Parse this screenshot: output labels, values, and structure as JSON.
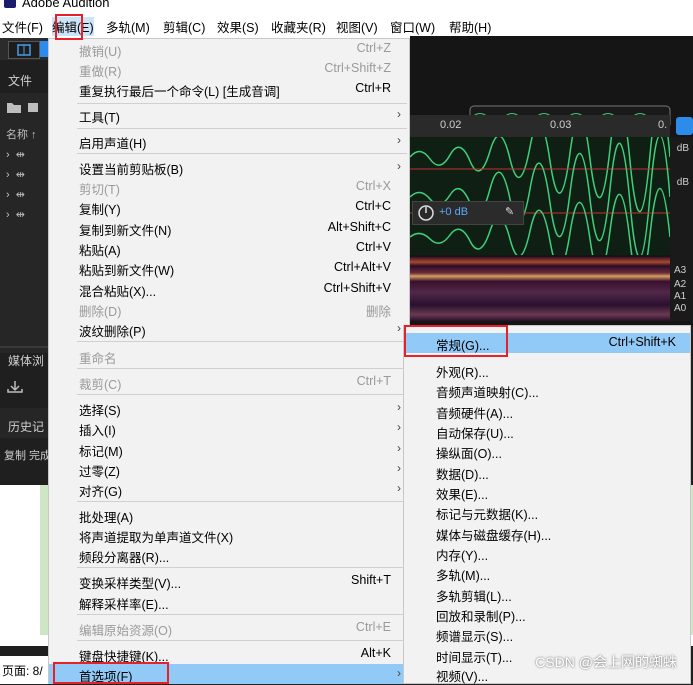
{
  "app": {
    "title": "Adobe Audition"
  },
  "menubar": [
    {
      "label": "文件(F)"
    },
    {
      "label": "编辑(E)"
    },
    {
      "label": "多轨(M)"
    },
    {
      "label": "剪辑(C)"
    },
    {
      "label": "效果(S)"
    },
    {
      "label": "收藏夹(R)"
    },
    {
      "label": "视图(V)"
    },
    {
      "label": "窗口(W)"
    },
    {
      "label": "帮助(H)"
    }
  ],
  "left_panel": {
    "files_tab": "文件",
    "name_col": "名称 ↑",
    "media_tab": "媒体浏",
    "history_tab": "历史记",
    "copy_status": "复制 完成",
    "page_status": "页面: 8/"
  },
  "waveform": {
    "ruler_ticks": [
      "0.02",
      "0.03",
      "0."
    ],
    "db_labels": [
      "dB",
      "dB"
    ],
    "volume": "+0 dB",
    "freq_labels": [
      "A3",
      "A2",
      "A1",
      "A0"
    ]
  },
  "edit_menu": {
    "items": [
      {
        "label": "撤销(U)",
        "shortcut": "Ctrl+Z",
        "disabled": true
      },
      {
        "label": "重做(R)",
        "shortcut": "Ctrl+Shift+Z",
        "disabled": true
      },
      {
        "label": "重复执行最后一个命令(L) [生成音调]",
        "shortcut": "Ctrl+R"
      },
      {
        "label": "工具(T)",
        "submenu": true
      },
      {
        "label": "启用声道(H)",
        "submenu": true
      },
      {
        "label": "设置当前剪贴板(B)",
        "submenu": true
      },
      {
        "label": "剪切(T)",
        "shortcut": "Ctrl+X",
        "disabled": true
      },
      {
        "label": "复制(Y)",
        "shortcut": "Ctrl+C"
      },
      {
        "label": "复制到新文件(N)",
        "shortcut": "Alt+Shift+C"
      },
      {
        "label": "粘贴(A)",
        "shortcut": "Ctrl+V"
      },
      {
        "label": "粘贴到新文件(W)",
        "shortcut": "Ctrl+Alt+V"
      },
      {
        "label": "混合粘贴(X)...",
        "shortcut": "Ctrl+Shift+V"
      },
      {
        "label": "删除(D)",
        "shortcut": "删除",
        "disabled": true
      },
      {
        "label": "波纹删除(P)",
        "submenu": true
      },
      {
        "label": "重命名",
        "disabled": true
      },
      {
        "label": "裁剪(C)",
        "shortcut": "Ctrl+T",
        "disabled": true
      },
      {
        "label": "选择(S)",
        "submenu": true
      },
      {
        "label": "插入(I)",
        "submenu": true
      },
      {
        "label": "标记(M)",
        "submenu": true
      },
      {
        "label": "过零(Z)",
        "submenu": true
      },
      {
        "label": "对齐(G)",
        "submenu": true
      },
      {
        "label": "批处理(A)"
      },
      {
        "label": "将声道提取为单声道文件(X)"
      },
      {
        "label": "频段分离器(R)..."
      },
      {
        "label": "变换采样类型(V)...",
        "shortcut": "Shift+T"
      },
      {
        "label": "解释采样率(E)..."
      },
      {
        "label": "编辑原始资源(O)",
        "shortcut": "Ctrl+E",
        "disabled": true
      },
      {
        "label": "键盘快捷键(K)...",
        "shortcut": "Alt+K"
      },
      {
        "label": "首选项(F)",
        "submenu": true,
        "highlighted": true
      }
    ]
  },
  "prefs_submenu": {
    "items": [
      {
        "label": "常规(G)...",
        "shortcut": "Ctrl+Shift+K",
        "highlighted": true
      },
      {
        "label": "外观(R)..."
      },
      {
        "label": "音频声道映射(C)..."
      },
      {
        "label": "音频硬件(A)..."
      },
      {
        "label": "自动保存(U)..."
      },
      {
        "label": "操纵面(O)..."
      },
      {
        "label": "数据(D)..."
      },
      {
        "label": "效果(E)..."
      },
      {
        "label": "标记与元数据(K)..."
      },
      {
        "label": "媒体与磁盘缓存(H)..."
      },
      {
        "label": "内存(Y)..."
      },
      {
        "label": "多轨(M)..."
      },
      {
        "label": "多轨剪辑(L)..."
      },
      {
        "label": "回放和录制(P)..."
      },
      {
        "label": "频谱显示(S)..."
      },
      {
        "label": "时间显示(T)..."
      },
      {
        "label": "视频(V)..."
      }
    ]
  },
  "watermark": "CSDN @会上网的蜘蛛",
  "colors": {
    "highlight": "#91c9f7",
    "annotation": "#e8202a",
    "accent": "#2d8ceb"
  }
}
